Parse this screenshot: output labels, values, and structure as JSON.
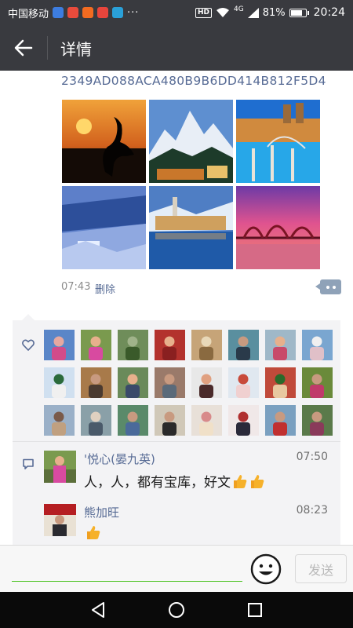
{
  "status_bar": {
    "carrier": "中国移动",
    "more": "···",
    "hd": "HD",
    "network": "4G",
    "battery": "81%",
    "battery_level": 0.81,
    "time": "20:24"
  },
  "header": {
    "title": "详情",
    "back_icon": "arrow-left-icon"
  },
  "post": {
    "hash_text": "2349AD088ACA480B9B6DD414B812F5D4",
    "photos": [
      {
        "name": "photo-crane-sunset"
      },
      {
        "name": "photo-snow-mountains"
      },
      {
        "name": "photo-city-night-river"
      },
      {
        "name": "photo-snowy-forest"
      },
      {
        "name": "photo-lakeside-town"
      },
      {
        "name": "photo-bridge-sunset"
      }
    ],
    "time": "07:43",
    "delete_label": "删除"
  },
  "likes": {
    "icon": "heart-icon",
    "count_shown": 24
  },
  "comments": [
    {
      "name": "'悦心(晏九英)",
      "time": "07:50",
      "text": "人，人，都有宝库，好文",
      "emoji": [
        "thumbs-up",
        "thumbs-up"
      ]
    },
    {
      "name": "熊加旺",
      "time": "08:23",
      "text": "",
      "emoji": [
        "thumbs-up"
      ]
    }
  ],
  "input_bar": {
    "placeholder": "",
    "emoji_icon": "smiley-face-icon",
    "send_label": "发送"
  },
  "nav_bar": {
    "back_icon": "nav-back-icon",
    "home_icon": "nav-home-icon",
    "recents_icon": "nav-recents-icon"
  },
  "colors": {
    "header_bg": "#393a3f",
    "link_blue": "#576b95",
    "input_underline": "#45c01a"
  }
}
